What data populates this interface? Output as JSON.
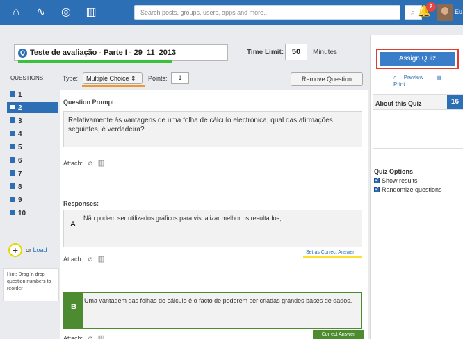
{
  "topbar": {
    "search_placeholder": "Search posts, groups, users, apps and more...",
    "notification_count": "2",
    "user_label": "Eu",
    "nav_icons": [
      "home-icon",
      "activity-icon",
      "compass-icon",
      "book-icon"
    ]
  },
  "quiz": {
    "title": "Teste de avaliação - Parte I - 29_11_2013",
    "time_limit_label": "Time Limit:",
    "time_limit_value": "50",
    "minutes_label": "Minutes"
  },
  "sidebar": {
    "assign_label": "Assign Quiz",
    "preview_label": "Preview",
    "print_label": "Print",
    "about_title": "About this Quiz",
    "about_count": "16",
    "options_title": "Quiz Options",
    "options": [
      {
        "label": "Show results",
        "checked": true
      },
      {
        "label": "Randomize questions",
        "checked": true
      }
    ]
  },
  "questions": {
    "header": "QUESTIONS",
    "items": [
      "1",
      "2",
      "3",
      "4",
      "5",
      "6",
      "7",
      "8",
      "9",
      "10"
    ],
    "active_index": 1,
    "or_label": "or",
    "load_label": "Load",
    "hint": "Hint: Drag 'n drop question numbers to reorder"
  },
  "editor": {
    "type_label": "Type:",
    "type_value": "Multiple Choice",
    "points_label": "Points:",
    "points_value": "1",
    "remove_label": "Remove Question",
    "prompt_label": "Question Prompt:",
    "prompt_text": "Relativamente às vantagens de uma folha de cálculo electrónica, qual das afirmações seguintes, é verdadeira?",
    "attach_label": "Attach:",
    "responses_label": "Responses:",
    "responses": [
      {
        "letter": "A",
        "text": "Não podem ser utilizados gráficos para visualizar melhor os resultados;"
      },
      {
        "letter": "B",
        "text": "Uma vantagem das folhas de cálculo é o facto de poderem ser criadas grandes bases de dados."
      }
    ],
    "set_correct_label": "Set as Correct Answer",
    "correct_answer_label": "Correct Answer"
  },
  "colors": {
    "brand_blue": "#2d6fb5",
    "highlight_red": "#e23b2f",
    "highlight_green": "#3cc13c",
    "highlight_orange": "#f09830",
    "highlight_yellow": "#ffe030",
    "correct_green": "#4c8b2f"
  }
}
